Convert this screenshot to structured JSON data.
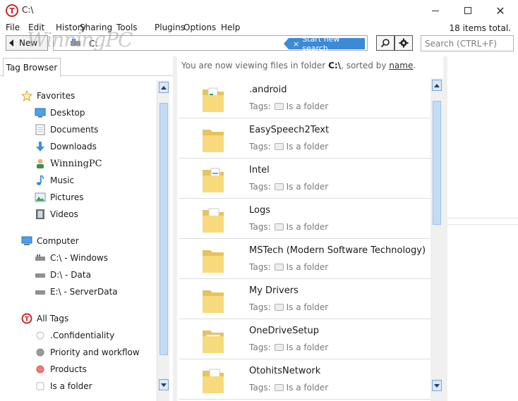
{
  "window": {
    "title": "C:\\",
    "close_glyph": "✕"
  },
  "menu": [
    "File",
    "Edit",
    "History",
    "Sharing",
    "Tools",
    "Plugins",
    "Options",
    "Help"
  ],
  "item_count": "18 items total.",
  "toolbar": {
    "new_label": "New",
    "address": "C:",
    "start_search": "Start new search",
    "start_search_x": "×",
    "search_placeholder": "Search (CTRL+F)",
    "watermark": "WinningPC"
  },
  "left_tab": "Tag Browser",
  "tree": {
    "favorites_label": "Favorites",
    "favorites": [
      {
        "label": "Desktop",
        "icon": "desktop-icon"
      },
      {
        "label": "Documents",
        "icon": "documents-icon"
      },
      {
        "label": "Downloads",
        "icon": "downloads-icon"
      },
      {
        "label": "WinningPC",
        "icon": "user-icon"
      },
      {
        "label": "Music",
        "icon": "music-icon"
      },
      {
        "label": "Pictures",
        "icon": "pictures-icon"
      },
      {
        "label": "Videos",
        "icon": "videos-icon"
      }
    ],
    "computer_label": "Computer",
    "drives": [
      {
        "label": "C:\\ - Windows"
      },
      {
        "label": "D:\\ - Data"
      },
      {
        "label": "E:\\ - ServerData"
      }
    ],
    "tags_label": "All Tags",
    "tags": [
      {
        "label": ".Confidentiality",
        "color": "#ffffff"
      },
      {
        "label": "Priority and workflow",
        "color": "#9a9a9a"
      },
      {
        "label": "Products",
        "color": "#f07a7a"
      },
      {
        "label": "Is a folder",
        "color": "#ffffff"
      }
    ]
  },
  "viewing": {
    "prefix": "You are now viewing files in folder",
    "folder": "C:\\",
    "mid": ", sorted by",
    "sort": "name",
    "suffix": "."
  },
  "files": [
    {
      "name": ".android",
      "tag": "Is a folder",
      "variant": "green-doc"
    },
    {
      "name": "EasySpeech2Text",
      "tag": "Is a folder",
      "variant": "plain"
    },
    {
      "name": "Intel",
      "tag": "Is a folder",
      "variant": "blue-doc"
    },
    {
      "name": "Logs",
      "tag": "Is a folder",
      "variant": "red-doc"
    },
    {
      "name": "MSTech (Modern Software Technology)",
      "tag": "Is a folder",
      "variant": "plain"
    },
    {
      "name": "My Drivers",
      "tag": "Is a folder",
      "variant": "plain"
    },
    {
      "name": "OneDriveSetup",
      "tag": "Is a folder",
      "variant": "onedrive"
    },
    {
      "name": "OtohitsNetwork",
      "tag": "Is a folder",
      "variant": "doc"
    }
  ],
  "tags_prefix": "Tags:",
  "colors": {
    "accent": "#3b8ad6",
    "app_red": "#c8262c",
    "folder": "#f5d77a"
  }
}
